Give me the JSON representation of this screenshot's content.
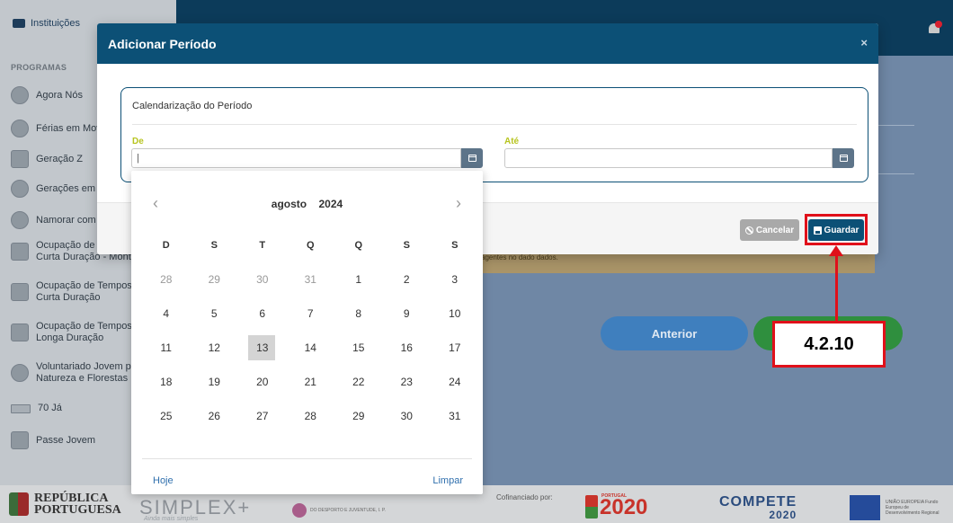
{
  "sidebar": {
    "institutions": "Instituições",
    "section_heading": "PROGRAMAS",
    "items": [
      {
        "line1": "Agora Nós",
        "line2": ""
      },
      {
        "line1": "Férias em Movim",
        "line2": ""
      },
      {
        "line1": "Geração Z",
        "line2": ""
      },
      {
        "line1": "Gerações em Re",
        "line2": ""
      },
      {
        "line1": "Namorar com Fa",
        "line2": ""
      },
      {
        "line1": "Ocupação de Te",
        "line2": "Curta Duração - Mont"
      },
      {
        "line1": "Ocupação de Tempos",
        "line2": "Curta Duração"
      },
      {
        "line1": "Ocupação de Tempos",
        "line2": "Longa Duração"
      },
      {
        "line1": "Voluntariado Jovem p",
        "line2": "Natureza e Florestas"
      },
      {
        "line1": "70 Já",
        "line2": ""
      },
      {
        "line1": "Passe Jovem",
        "line2": ""
      }
    ]
  },
  "modal": {
    "title": "Adicionar Período",
    "close": "×",
    "fieldset_title": "Calendarização do Período",
    "from_label": "De",
    "from_value": "|",
    "to_label": "Até",
    "to_value": "",
    "cancel_label": "Cancelar",
    "save_label": "Guardar"
  },
  "datepicker": {
    "prev": "‹",
    "next": "›",
    "month": "agosto",
    "year": "2024",
    "weekdays": [
      "D",
      "S",
      "T",
      "Q",
      "Q",
      "S",
      "S"
    ],
    "weeks": [
      [
        "28",
        "29",
        "30",
        "31",
        "1",
        "2",
        "3"
      ],
      [
        "4",
        "5",
        "6",
        "7",
        "8",
        "9",
        "10"
      ],
      [
        "11",
        "12",
        "13",
        "14",
        "15",
        "16",
        "17"
      ],
      [
        "18",
        "19",
        "20",
        "21",
        "22",
        "23",
        "24"
      ],
      [
        "25",
        "26",
        "27",
        "28",
        "29",
        "30",
        "31"
      ]
    ],
    "other_month_count_first_row": 4,
    "today": "13",
    "today_button": "Hoje",
    "clear_button": "Limpar"
  },
  "background": {
    "warning_text": "agentes no dado dados.",
    "previous_button": "Anterior"
  },
  "footer": {
    "republica_line1": "REPÚBLICA",
    "republica_line2": "PORTUGUESA",
    "simplex": "SIMPLEX+",
    "simplex_sub": "Ainda mais simples",
    "ipdj": "DO DESPORTO E JUVENTUDE, I. P.",
    "cofinanciado": "Cofinanciado por:",
    "portugal2020_small": "PORTUGAL",
    "portugal2020": "2020",
    "compete": "COMPETE",
    "compete_year": "2020",
    "ue_text": "UNIÃO EUROPEIA Fundo Europeu de Desenvolvimento Regional"
  },
  "annotation": {
    "label": "4.2.10",
    "color": "#e0101a"
  },
  "colors": {
    "header": "#0c5076",
    "topbar": "#0c3b5a",
    "label_accent": "#b7c41f",
    "link": "#2f6fad"
  }
}
